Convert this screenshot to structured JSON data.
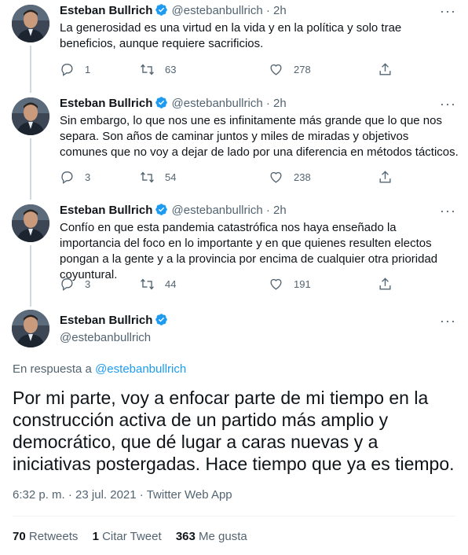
{
  "colors": {
    "accent": "#1d9bf0",
    "text_primary": "#0f1419",
    "text_secondary": "#536471",
    "divider": "#eff3f4"
  },
  "author": {
    "name": "Esteban Bullrich",
    "handle": "@estebanbullrich",
    "verified_icon": "verified-badge-icon"
  },
  "thread": [
    {
      "time": "2h",
      "text": "La generosidad es una virtud en la vida y en la política y solo trae beneficios, aunque requiere sacrificios.",
      "replies": "1",
      "retweets": "63",
      "likes": "278"
    },
    {
      "time": "2h",
      "text": "Sin embargo, lo que nos une es infinitamente más grande que lo que nos separa. Son años de caminar juntos y miles de miradas y objetivos comunes que no voy a dejar de lado por una diferencia en métodos tácticos.",
      "replies": "3",
      "retweets": "54",
      "likes": "238"
    },
    {
      "time": "2h",
      "text": "Confío en que esta pandemia catastrófica nos haya enseñado la importancia del foco en lo importante y en que quienes resulten electos pongan a la gente y a la provincia por encima de cualquier otra prioridad coyuntural.",
      "replies": "3",
      "retweets": "44",
      "likes": "191"
    }
  ],
  "main_tweet": {
    "reply_prefix": "En respuesta a",
    "reply_handle": "@estebanbullrich",
    "text": "Por mi parte, voy a enfocar parte de mi tiempo en la construcción activa de un partido más amplio y democrático, que dé lugar a caras nuevas y a iniciativas postergadas. Hace tiempo que ya es tiempo.",
    "time": "6:32 p. m.",
    "date": "23 jul. 2021",
    "source": "Twitter Web App",
    "sep": "·",
    "retweets_count": "70",
    "retweets_label": "Retweets",
    "quotes_count": "1",
    "quotes_label": "Citar Tweet",
    "likes_count": "363",
    "likes_label": "Me gusta"
  }
}
